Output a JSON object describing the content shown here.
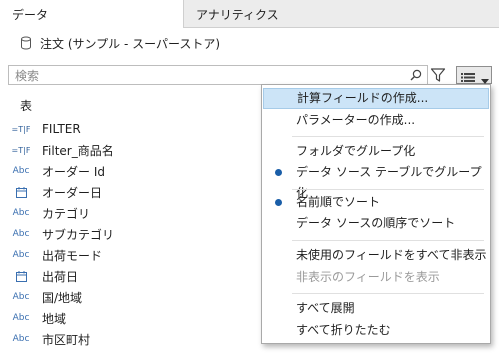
{
  "tabs": {
    "data": "データ",
    "analytics": "アナリティクス"
  },
  "datasource": {
    "name": "注文 (サンプル - スーパーストア)"
  },
  "search": {
    "placeholder": "検索"
  },
  "fields": {
    "section_title": "表",
    "items": [
      {
        "label": "FILTER",
        "type": "set-param"
      },
      {
        "label": "Filter_商品名",
        "type": "set-param"
      },
      {
        "label": "オーダー Id",
        "type": "string"
      },
      {
        "label": "オーダー日",
        "type": "date"
      },
      {
        "label": "カテゴリ",
        "type": "string"
      },
      {
        "label": "サブカテゴリ",
        "type": "string"
      },
      {
        "label": "出荷モード",
        "type": "string"
      },
      {
        "label": "出荷日",
        "type": "date"
      },
      {
        "label": "国/地域",
        "type": "string"
      },
      {
        "label": "地域",
        "type": "string"
      },
      {
        "label": "市区町村",
        "type": "string"
      }
    ],
    "type_labels": {
      "string": "Abc",
      "set_param": "=T|F"
    }
  },
  "menu": {
    "items": [
      {
        "label": "計算フィールドの作成...",
        "highlighted": true
      },
      {
        "label": "パラメーターの作成..."
      },
      {
        "label": "フォルダでグループ化"
      },
      {
        "label": "データ ソース テーブルでグループ化",
        "checked": true
      },
      {
        "label": "名前順でソート",
        "checked": true
      },
      {
        "label": "データ ソースの順序でソート"
      },
      {
        "label": "未使用のフィールドをすべて非表示"
      },
      {
        "label": "非表示のフィールドを表示",
        "disabled": true
      },
      {
        "label": "すべて展開"
      },
      {
        "label": "すべて折りたたむ"
      }
    ]
  },
  "colors": {
    "highlight": "#cce4f7",
    "accent": "#1a5ea8",
    "type_icon": "#3a6fb0"
  }
}
